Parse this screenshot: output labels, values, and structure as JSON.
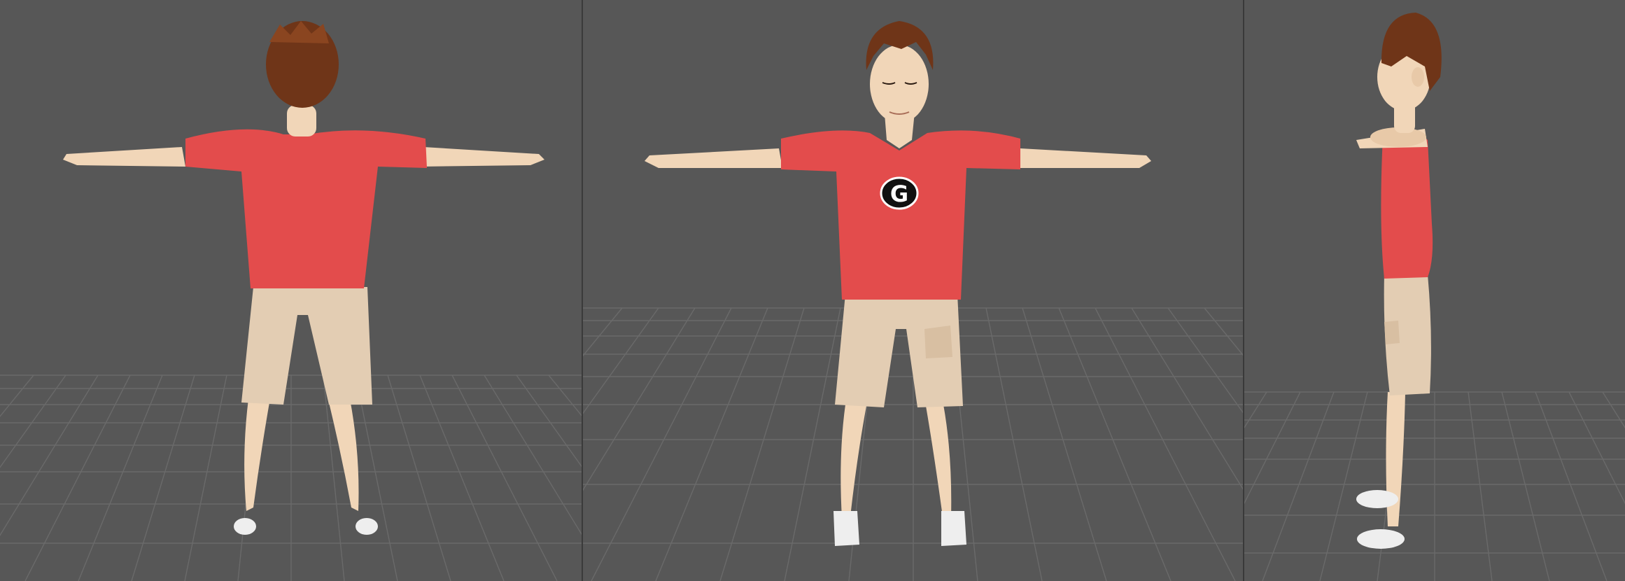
{
  "title": "",
  "colors": {
    "background": "#575757",
    "grid": "#6a6a6a",
    "shirt": "#e34c4c",
    "shorts": "#e3cdb3",
    "skin": "#f1d6b8",
    "hair": "#6f3518",
    "shoe": "#eeeeee"
  },
  "viewports": [
    {
      "view": "back",
      "label": ""
    },
    {
      "view": "front",
      "label": ""
    },
    {
      "view": "side",
      "label": ""
    }
  ],
  "logo": {
    "letter": "G"
  }
}
